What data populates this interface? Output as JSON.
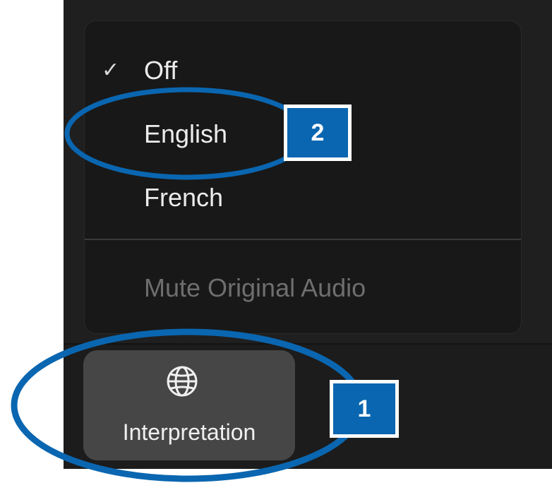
{
  "menu": {
    "items": [
      {
        "label": "Off",
        "checked": true
      },
      {
        "label": "English",
        "checked": false
      },
      {
        "label": "French",
        "checked": false
      }
    ],
    "check_glyph": "✓",
    "mute_original_audio": {
      "label": "Mute Original Audio",
      "enabled": false
    }
  },
  "toolbar": {
    "interpretation_button": {
      "label": "Interpretation",
      "icon": "globe-icon"
    }
  },
  "annotations": {
    "callout_1": "1",
    "callout_2": "2",
    "highlight_color": "#0a66b0"
  }
}
